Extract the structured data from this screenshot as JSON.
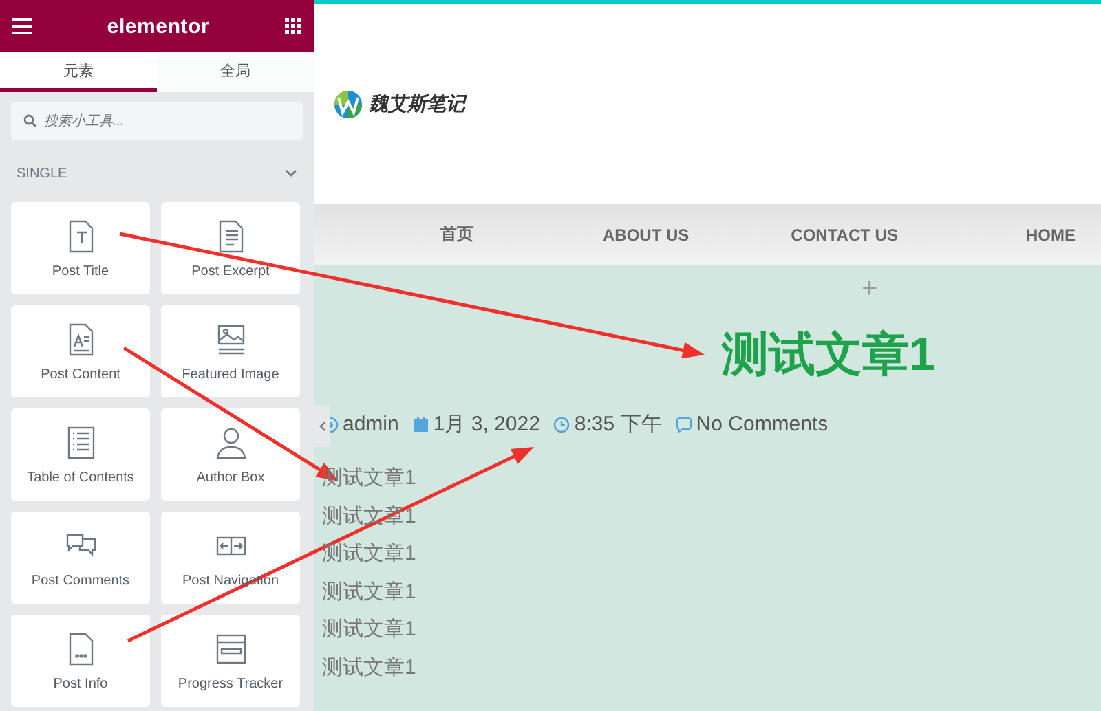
{
  "editor": {
    "logo": "elementor",
    "tabs": [
      {
        "label": "元素",
        "selected": true
      },
      {
        "label": "全局",
        "selected": false
      }
    ],
    "search": {
      "placeholder": "搜索小工具..."
    },
    "section": {
      "title": "SINGLE",
      "expanded": true
    },
    "widgets": [
      {
        "label": "Post Title"
      },
      {
        "label": "Post Excerpt"
      },
      {
        "label": "Post Content"
      },
      {
        "label": "Featured Image"
      },
      {
        "label": "Table of Contents"
      },
      {
        "label": "Author Box"
      },
      {
        "label": "Post Comments"
      },
      {
        "label": "Post Navigation"
      },
      {
        "label": "Post Info"
      },
      {
        "label": "Progress Tracker"
      }
    ]
  },
  "site": {
    "logo_text": "魏艾斯笔记",
    "nav": [
      "首页",
      "ABOUT US",
      "CONTACT US",
      "HOME"
    ],
    "add_button": "+",
    "post": {
      "title": "测试文章1",
      "meta": [
        {
          "kind": "author",
          "text": "admin"
        },
        {
          "kind": "date",
          "text": "1月 3, 2022"
        },
        {
          "kind": "time",
          "text": "8:35 下午"
        },
        {
          "kind": "comments",
          "text": "No Comments"
        }
      ],
      "paragraphs": [
        "测试文章1",
        "测试文章1",
        "测试文章1",
        "测试文章1",
        "测试文章1",
        "测试文章1"
      ]
    }
  }
}
